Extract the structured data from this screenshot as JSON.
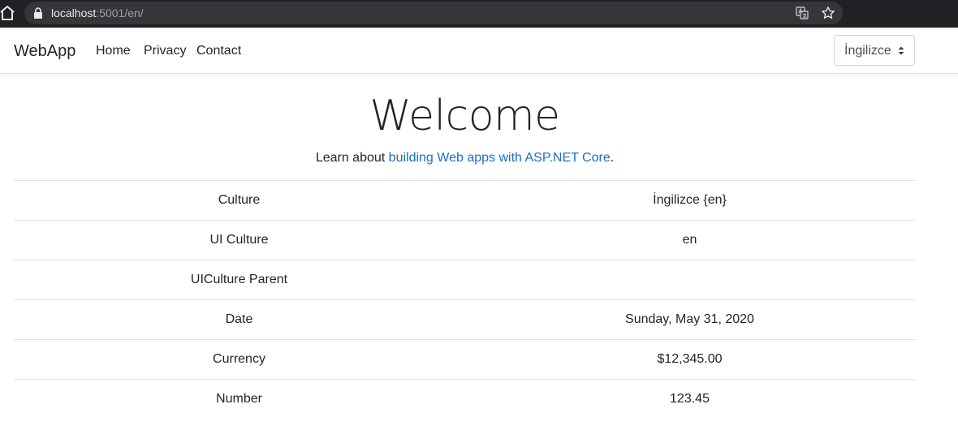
{
  "browser": {
    "url_host": "localhost",
    "url_rest": ":5001/en/"
  },
  "navbar": {
    "brand": "WebApp",
    "links": [
      "Home",
      "Privacy",
      "Contact"
    ],
    "language_select": {
      "selected": "İngilizce"
    }
  },
  "main": {
    "title": "Welcome",
    "lead_prefix": "Learn about ",
    "lead_link": "building Web apps with ASP.NET Core",
    "lead_suffix": "."
  },
  "table": {
    "rows": [
      {
        "label": "Culture",
        "value": "İngilizce {en}"
      },
      {
        "label": "UI Culture",
        "value": "en"
      },
      {
        "label": "UICulture Parent",
        "value": ""
      },
      {
        "label": "Date",
        "value": "Sunday, May 31, 2020"
      },
      {
        "label": "Currency",
        "value": "$12,345.00"
      },
      {
        "label": "Number",
        "value": "123.45"
      }
    ]
  },
  "colors": {
    "link": "#1b6ec2",
    "chrome_bg": "#202124",
    "omnibox_bg": "#35363a"
  },
  "icons": [
    "home-icon",
    "lock-icon",
    "translate-icon",
    "star-icon",
    "select-arrows-icon"
  ]
}
